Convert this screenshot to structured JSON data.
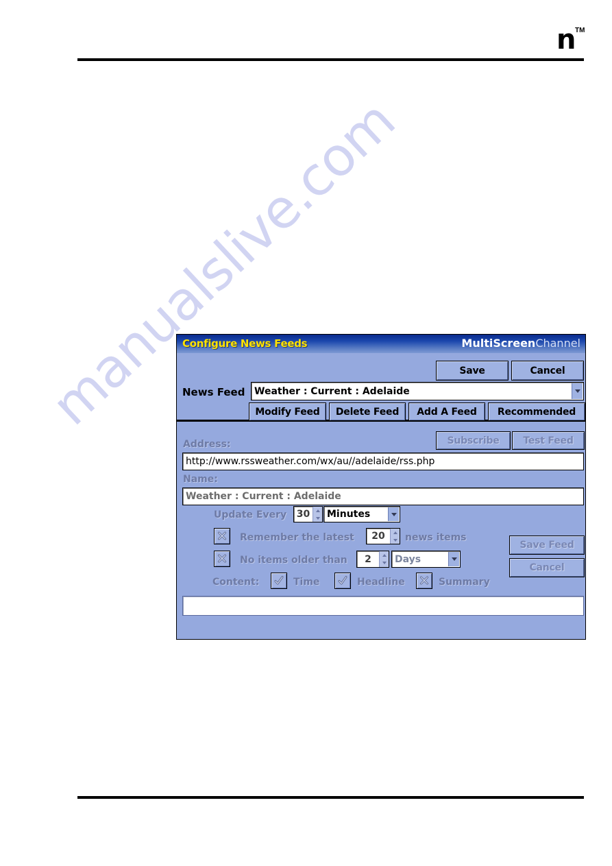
{
  "page": {
    "logo_mark": "n",
    "logo_tm": "TM",
    "watermark": "manualslive.com"
  },
  "dialog": {
    "title": "Configure News Feeds",
    "brand_bold": "MultiScreen",
    "brand_light": "Channel",
    "accent_title_color": "#ffe200",
    "panel_color": "#95a9de",
    "top": {
      "save_label": "Save",
      "cancel_label": "Cancel",
      "news_feed_label": "News Feed",
      "news_feed_value": "Weather : Current : Adelaide",
      "modify_feed_label": "Modify Feed",
      "delete_feed_label": "Delete Feed",
      "add_feed_label": "Add A Feed",
      "recommended_label": "Recommended"
    },
    "details": {
      "subscribe_label": "Subscribe",
      "test_feed_label": "Test Feed",
      "address_label": "Address:",
      "address_value": "http://www.rssweather.com/wx/au//adelaide/rss.php",
      "name_label": "Name:",
      "name_value": "Weather : Current : Adelaide",
      "update_every_label": "Update Every",
      "update_every_value": "30",
      "update_every_unit": "Minutes",
      "remember_label": "Remember the latest",
      "remember_value": "20",
      "remember_suffix": "news items",
      "no_items_label": "No items older than",
      "no_items_value": "2",
      "no_items_unit": "Days",
      "content_label": "Content:",
      "content_time_label": "Time",
      "content_headline_label": "Headline",
      "content_summary_label": "Summary",
      "save_feed_label": "Save Feed",
      "cancel_feed_label": "Cancel",
      "status_value": ""
    },
    "checkboxes": {
      "remember_state": "x-icon",
      "no_items_state": "x-icon",
      "time_state": "check-icon",
      "headline_state": "check-icon",
      "summary_state": "x-icon"
    }
  }
}
